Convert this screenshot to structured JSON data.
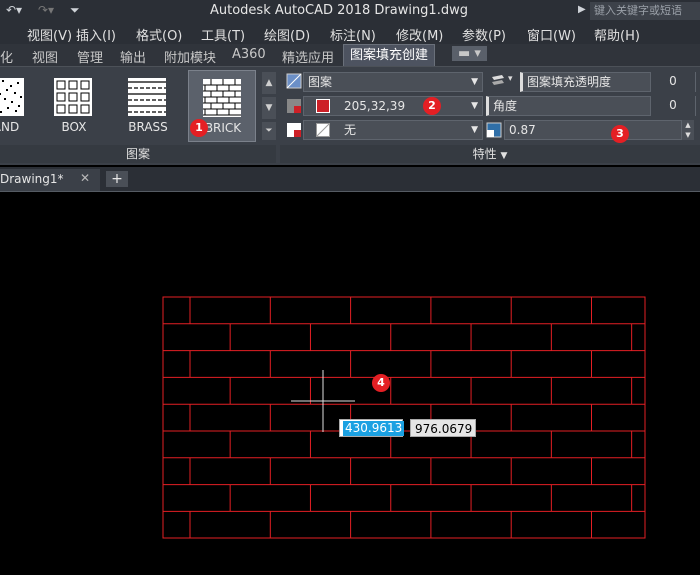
{
  "titlebar": {
    "title": "Autodesk AutoCAD 2018    Drawing1.dwg",
    "search_placeholder": "键入关键字或短语"
  },
  "menu": {
    "items": [
      "视图(V)",
      "插入(I)",
      "格式(O)",
      "工具(T)",
      "绘图(D)",
      "标注(N)",
      "修改(M)",
      "参数(P)",
      "窗口(W)",
      "帮助(H)"
    ]
  },
  "ribbon_tabs": {
    "items": [
      "化",
      "视图",
      "管理",
      "输出",
      "附加模块",
      "A360",
      "精选应用",
      "图案填充创建"
    ],
    "active": "图案填充创建"
  },
  "pattern_panel": {
    "patterns": [
      "AND",
      "BOX",
      "BRASS",
      "BRICK"
    ],
    "selected": "BRICK",
    "label": "图案"
  },
  "properties_panel": {
    "label": "特性",
    "type_value": "图案",
    "color_value": "205,32,39",
    "color_hex": "#cd2027",
    "background_value": "无",
    "transparency_label": "图案填充透明度",
    "transparency_value": "0",
    "angle_label": "角度",
    "angle_value": "0",
    "scale_value": "0.87"
  },
  "doc_tabs": {
    "active": "Drawing1*",
    "plus": "+"
  },
  "canvas": {
    "hatch_color": "#e41f24",
    "coord_x": "430.9613",
    "coord_y": "976.0679"
  },
  "annotations": [
    "1",
    "2",
    "3",
    "4"
  ]
}
